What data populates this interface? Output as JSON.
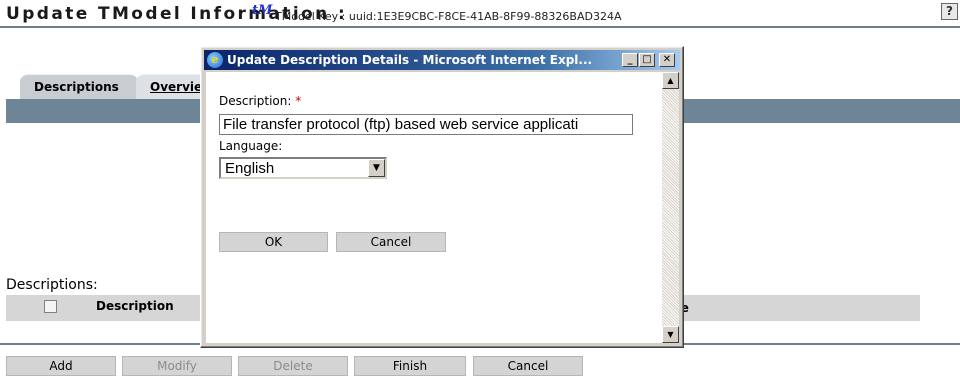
{
  "header": {
    "title": "Update TModel Information :",
    "tm_logo": "tM",
    "tmodel_key": "TModel Key : uuid:1E3E9CBC-F8CE-41AB-8F99-88326BAD324A",
    "help_icon": "?"
  },
  "tabs": [
    {
      "label": "Descriptions"
    },
    {
      "label": "Overvie"
    }
  ],
  "descriptions": {
    "heading": "Descriptions:",
    "columns": {
      "description": "Description",
      "language": "age"
    }
  },
  "buttons": {
    "add": "Add",
    "modify": "Modify",
    "delete": "Delete",
    "finish": "Finish",
    "cancel": "Cancel"
  },
  "popup": {
    "title": "Update Description Details - Microsoft Internet Expl...",
    "description_label": "Description:",
    "required_mark": "*",
    "description_value": "File transfer protocol (ftp) based web service applicati",
    "language_label": "Language:",
    "language_value": "English",
    "ok_label": "OK",
    "cancel_label": "Cancel"
  },
  "icons": {
    "help": "help-icon",
    "ie": "internet-explorer-icon",
    "minimize": "minimize-icon",
    "maximize": "maximize-icon",
    "close": "close-icon",
    "dropdown": "chevron-down-icon"
  },
  "colors": {
    "tab_strip": "#6e8497",
    "popup_titlebar": "#0a246a",
    "required": "#cc0000"
  }
}
